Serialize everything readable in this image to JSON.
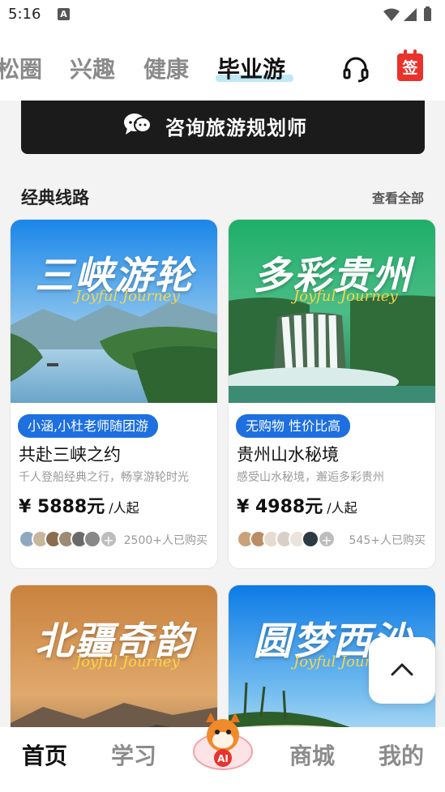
{
  "status_bar": {
    "time": "5:16",
    "badge": "A"
  },
  "top_nav": {
    "tabs": [
      {
        "label": "松圈"
      },
      {
        "label": "兴趣"
      },
      {
        "label": "健康"
      },
      {
        "label": "毕业游"
      }
    ],
    "sign_label": "签",
    "headset_icon": "headset-icon"
  },
  "consult_button": {
    "label": "咨询旅游规划师",
    "icon": "chat-bubbles-icon"
  },
  "section": {
    "title": "经典线路",
    "more": "查看全部"
  },
  "cards": [
    {
      "art_title": "三峡游轮",
      "script": "Joyful Journey",
      "tag": "小涵,小杜老师随团游",
      "name": "共赴三峡之约",
      "desc": "千人登船经典之行，畅享游轮时光",
      "price": "¥ 5888元",
      "unit": " /人起",
      "buyers": "2500+人已购买",
      "plus": "+"
    },
    {
      "art_title": "多彩贵州",
      "script": "Joyful Journey",
      "tag": "无购物 性价比高",
      "name": "贵州山水秘境",
      "desc": "感受山水秘境，邂逅多彩贵州",
      "price": "¥ 4988元",
      "unit": " /人起",
      "buyers": "545+人已购买",
      "plus": "+"
    },
    {
      "art_title": "北疆奇韵",
      "script": "Joyful Journey"
    },
    {
      "art_title": "圆梦西沙",
      "script": "Joyful Journey"
    }
  ],
  "bottom_nav": {
    "tabs": [
      {
        "label": "首页"
      },
      {
        "label": "学习"
      },
      {
        "label": "商城"
      },
      {
        "label": "我的"
      }
    ],
    "ai_label": "AI"
  },
  "colors": {
    "accent_blue": "#1e6fe0",
    "sign_red": "#e8322b",
    "dark_button": "#1b1b1b"
  }
}
